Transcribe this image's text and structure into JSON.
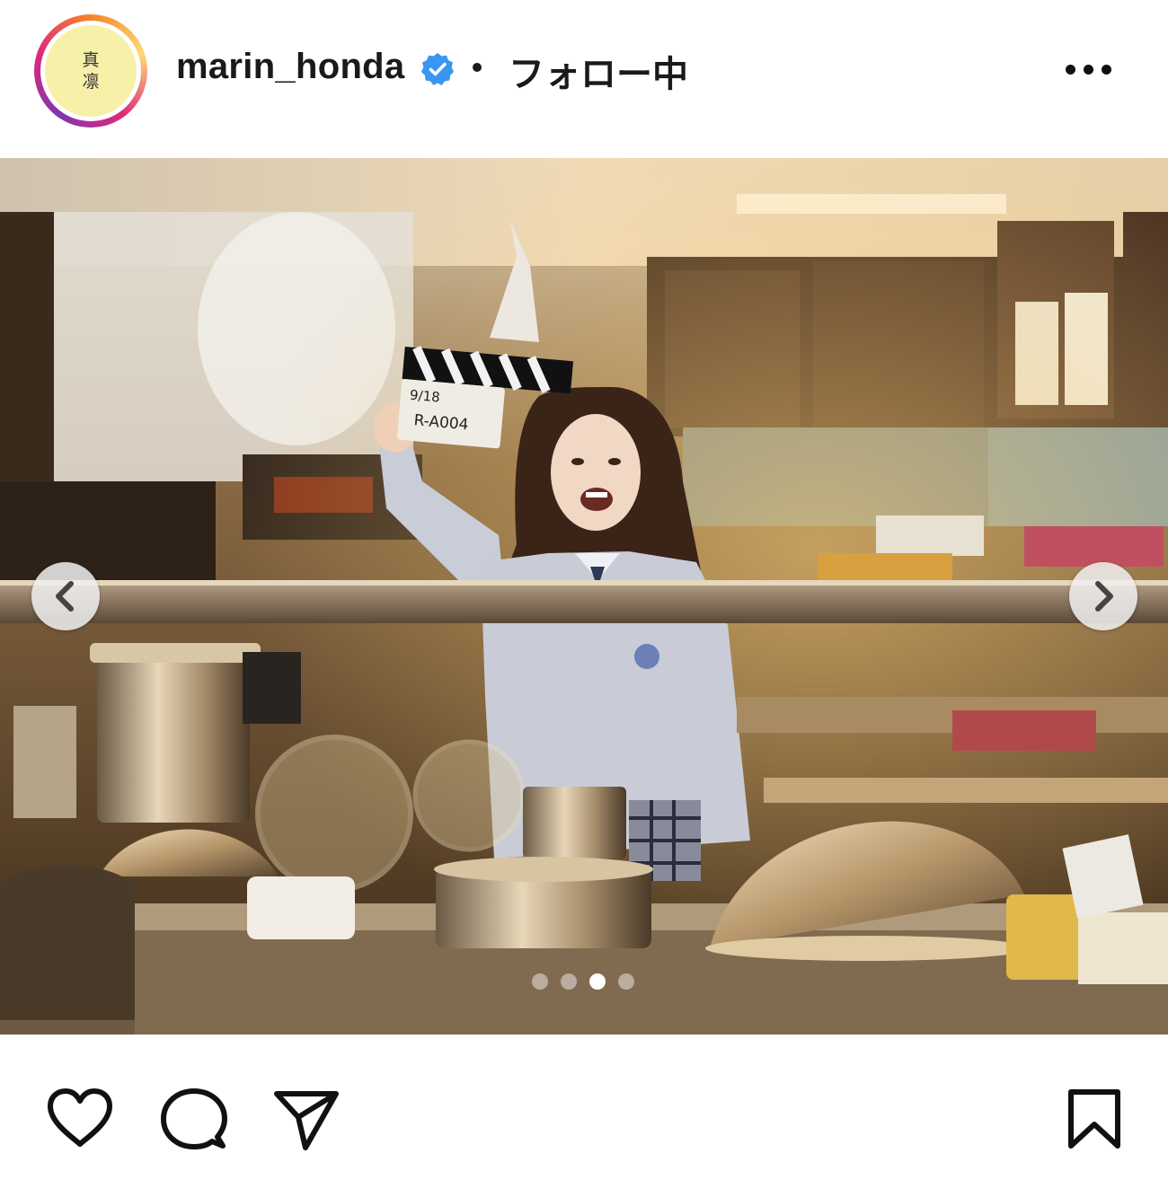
{
  "header": {
    "avatar_text": [
      "真",
      "凛"
    ],
    "username": "marin_honda",
    "verified_icon": "verified-badge-icon",
    "separator": "•",
    "follow_status": "フォロー中",
    "more_icon": "more-horizontal-icon"
  },
  "post": {
    "image_description_icon": "post-photo",
    "clapperboard_text": [
      "9/18",
      "R-A004"
    ],
    "carousel": {
      "total": 4,
      "active_index": 2,
      "prev_icon": "chevron-left-icon",
      "next_icon": "chevron-right-icon"
    }
  },
  "actions": {
    "like_icon": "heart-icon",
    "comment_icon": "comment-icon",
    "share_icon": "paper-plane-icon",
    "save_icon": "bookmark-icon"
  },
  "colors": {
    "verified": "#3897f0",
    "avatar_bg": "#f7f0a8",
    "text": "#1a1a1a"
  }
}
